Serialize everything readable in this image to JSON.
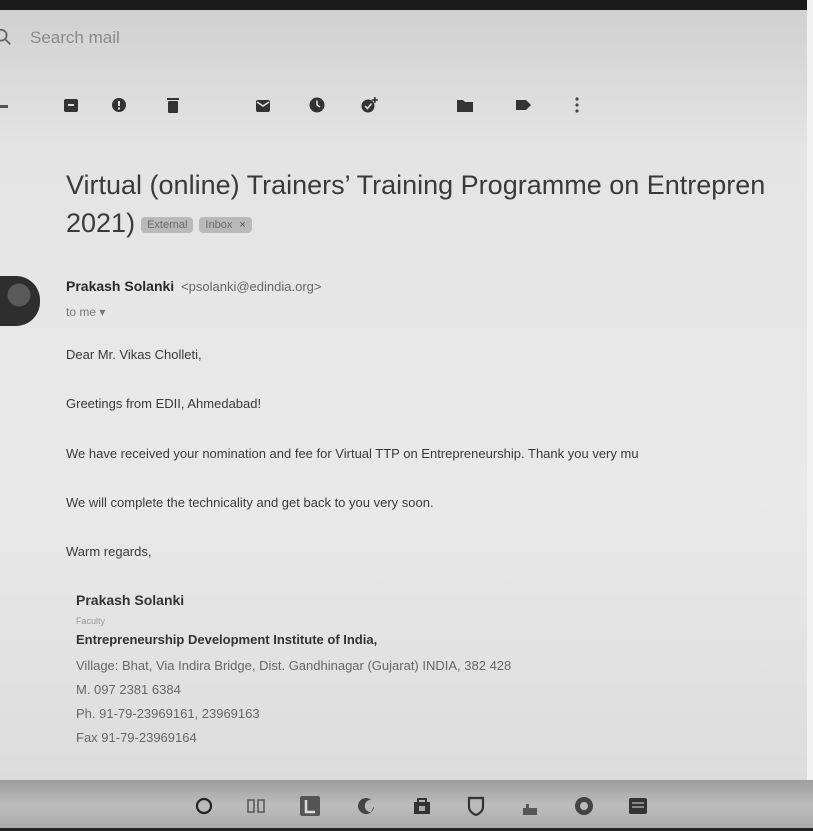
{
  "search": {
    "placeholder": "Search mail"
  },
  "toolbar": {
    "icons": [
      "archive-icon",
      "report-spam-icon",
      "delete-icon",
      "mark-unread-icon",
      "snooze-icon",
      "add-task-icon",
      "move-to-icon",
      "labels-icon",
      "more-vert-icon"
    ]
  },
  "email": {
    "subject_line1": "Virtual (online) Trainers’ Training Programme on Entrepren",
    "subject_line2": "2021)",
    "labels": [
      {
        "text": "External"
      },
      {
        "text": "Inbox",
        "close": "×"
      }
    ],
    "sender_name": "Prakash Solanki",
    "sender_email": "<psolanki@edindia.org>",
    "to": "to me ▾",
    "body": [
      "Dear Mr. Vikas Cholleti,",
      "Greetings from EDII, Ahmedabad!",
      "We have received your nomination and fee for Virtual TTP on Entrepreneurship. Thank you very mu",
      "We will complete the technicality and get back to you very soon.",
      "Warm regards,"
    ],
    "signature": {
      "name": "Prakash Solanki",
      "title": "Faculty",
      "org": "Entrepreneurship Development Institute of India,",
      "address": "Village: Bhat, Via Indira Bridge, Dist. Gandhinagar (Gujarat) INDIA, 382 428",
      "mobile": "M. 097 2381 6384",
      "phone": "Ph. 91-79-23969161, 23969163",
      "fax": "Fax 91-79-23969164"
    }
  },
  "taskbar": {
    "icons": [
      "search-circle-icon",
      "task-view-icon",
      "app-l-icon",
      "edge-browser-icon",
      "store-icon",
      "app-shield-icon",
      "file-explorer-icon",
      "chrome-icon",
      "word-icon"
    ]
  }
}
